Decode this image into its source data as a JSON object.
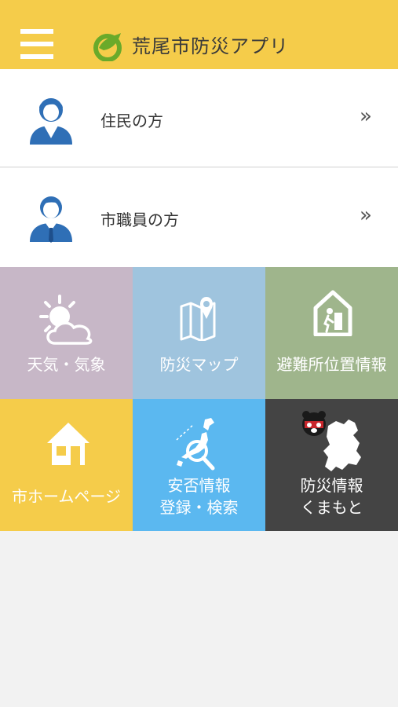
{
  "header": {
    "title": "荒尾市防災アプリ",
    "menu_icon": "hamburger-menu-icon",
    "logo_icon": "leaf-logo-icon",
    "bg_color": "#f5cc4a"
  },
  "user_menu": [
    {
      "label": "住民の方",
      "icon": "resident-avatar-icon",
      "chevron": "»"
    },
    {
      "label": "市職員の方",
      "icon": "staff-avatar-icon",
      "chevron": "»"
    }
  ],
  "tiles": [
    {
      "label": "天気・気象",
      "icon": "weather-sun-cloud-icon",
      "color": "#c7b7c7"
    },
    {
      "label": "防災マップ",
      "icon": "map-pin-icon",
      "color": "#9fc4de"
    },
    {
      "label": "避難所位置情報",
      "icon": "shelter-exit-icon",
      "color": "#9fb58c"
    },
    {
      "label": "市ホームページ",
      "icon": "home-icon",
      "color": "#f5cc4a"
    },
    {
      "label_line1": "安否情報",
      "label_line2": "登録・検索",
      "icon": "japan-map-search-icon",
      "color": "#5bb8f0"
    },
    {
      "label_line1": "防災情報",
      "label_line2": "くまもと",
      "icon": "kumamoto-mascot-map-icon",
      "color": "#444444"
    }
  ]
}
